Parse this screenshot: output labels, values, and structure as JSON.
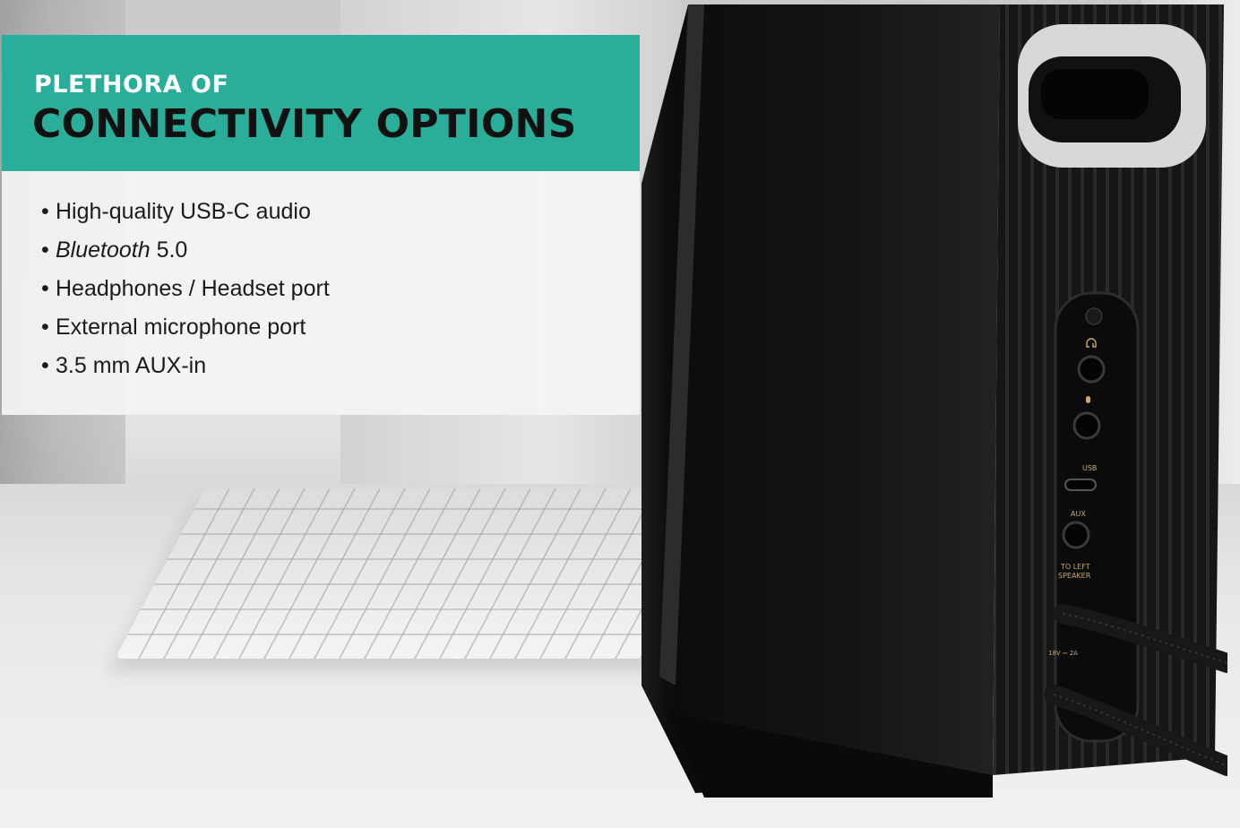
{
  "heading": {
    "kicker": "PLETHORA OF",
    "title": "CONNECTIVITY OPTIONS"
  },
  "features": [
    {
      "bullet": "•",
      "italic": "",
      "text": "High-quality USB-C audio"
    },
    {
      "bullet": "•",
      "italic": "Bluetooth",
      "text": " 5.0"
    },
    {
      "bullet": "•",
      "italic": "",
      "text": "Headphones / Headset port"
    },
    {
      "bullet": "•",
      "italic": "",
      "text": "External microphone port"
    },
    {
      "bullet": "•",
      "italic": "",
      "text": "3.5 mm AUX-in"
    }
  ],
  "speaker_labels": {
    "usb": "USB",
    "aux": "AUX",
    "to_left_1": "TO LEFT",
    "to_left_2": "SPEAKER",
    "power": "18V ⎓ 2A"
  },
  "colors": {
    "banner": "#2aae9a",
    "kicker_text": "#ffffff",
    "title_text": "#111111",
    "speaker_body": "#141414",
    "port_label": "#c9a86a"
  }
}
